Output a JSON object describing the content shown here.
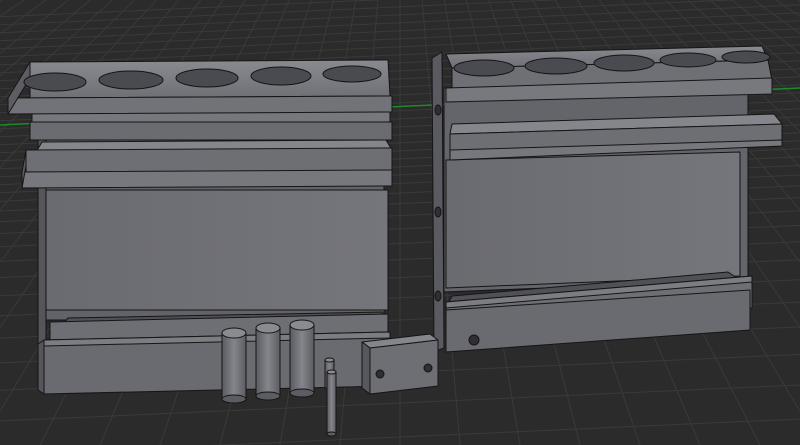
{
  "app": {
    "view": "3d-viewport",
    "theme": {
      "background": "#2b2b2b",
      "grid_line": "#3a3a3a",
      "x_axis": "#1f8a2a",
      "model_face": "#6c6c73",
      "model_face_dark": "#4f4f56",
      "model_face_light": "#85858c",
      "model_edge": "#151515"
    }
  },
  "scene": {
    "objects": [
      {
        "name": "test-tube-rack-left",
        "holes": 5
      },
      {
        "name": "test-tube-rack-right",
        "holes": 5
      },
      {
        "name": "cylinder-pin",
        "count": 3
      },
      {
        "name": "thin-pin",
        "count": 2
      },
      {
        "name": "connector-block",
        "holes": 2
      }
    ]
  }
}
